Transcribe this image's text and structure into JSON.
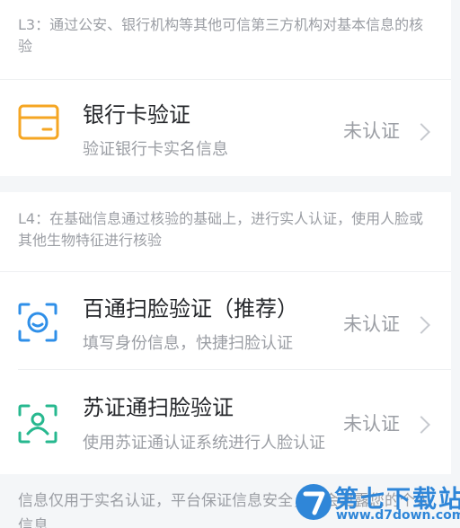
{
  "l3_section": {
    "desc": "L3：通过公安、银行机构等其他可信第三方机构对基本信息的核验",
    "items": [
      {
        "title": "银行卡验证",
        "subtitle": "验证银行卡实名信息",
        "status": "未认证",
        "icon": "bank-card-icon"
      }
    ]
  },
  "l4_section": {
    "desc": "L4：在基础信息通过核验的基础上，进行实人认证，使用人脸或其他生物特征进行核验",
    "items": [
      {
        "title": "百通扫脸验证（推荐）",
        "subtitle": "填写身份信息，快捷扫脸认证",
        "status": "未认证",
        "icon": "face-scan-icon"
      },
      {
        "title": "苏证通扫脸验证",
        "subtitle": "使用苏证通认证系统进行人脸认证",
        "status": "未认证",
        "icon": "person-scan-icon"
      }
    ]
  },
  "footer": {
    "text": "信息仅用于实名认证，平台保证信息安全，不会泄露您的个人信息"
  },
  "watermark": {
    "title": "第七下载站",
    "url": "www.d7down.com"
  },
  "colors": {
    "accent_orange": "#f5a623",
    "accent_blue": "#2f8fe8",
    "accent_teal": "#27b88f"
  }
}
